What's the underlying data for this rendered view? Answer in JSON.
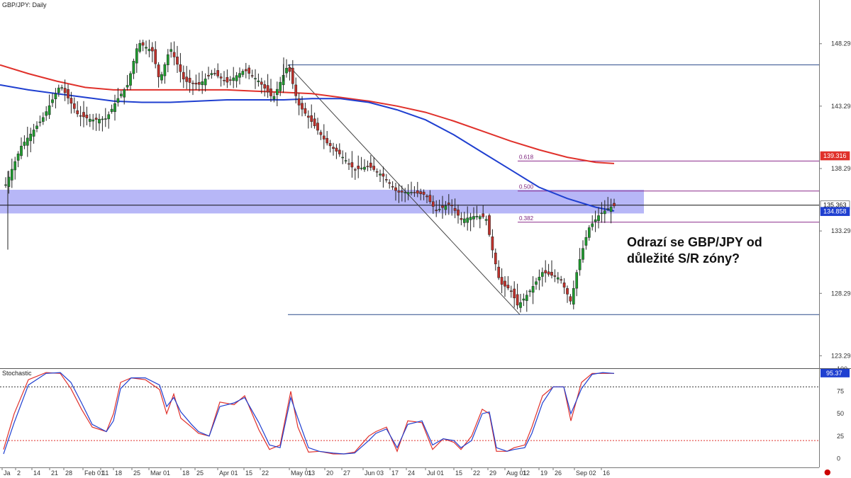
{
  "chart_data": [
    {
      "type": "candlestick",
      "title": "GBP/JPY: Daily",
      "symbol": "GBP/JPY",
      "timeframe": "Daily",
      "ylim": [
        122.3,
        151.8
      ],
      "y_ticks": [
        "148.298",
        "143.298",
        "138.298",
        "133.298",
        "128.298",
        "123.298"
      ],
      "y_tick_values": [
        148.298,
        143.298,
        138.298,
        133.298,
        128.298,
        123.298
      ],
      "x_tick_labels": [
        "Ja",
        "2",
        "14",
        "21",
        "28",
        "Feb 01",
        "11",
        "18",
        "25",
        "Mar 01",
        "18",
        "25",
        "Apr 01",
        "15",
        "22",
        "May 01",
        "13",
        "20",
        "27",
        "Jun 03",
        "17",
        "24",
        "Jul 01",
        "15",
        "22",
        "29",
        "Aug 01",
        "12",
        "19",
        "26",
        "Sep 02",
        "16"
      ],
      "price_badges": [
        {
          "label": "139.316",
          "value": 139.316,
          "color": "#e0312b"
        },
        {
          "label": "135.363",
          "value": 135.363,
          "color": "#ffffff"
        },
        {
          "label": "134.858",
          "value": 134.858,
          "color": "#1f3fd0"
        }
      ],
      "fib_levels": [
        {
          "label": "0.618",
          "value": 138.9
        },
        {
          "label": "0.500",
          "value": 136.5
        },
        {
          "label": "0.382",
          "value": 134.0
        }
      ],
      "swing_high": 146.6,
      "swing_low": 126.6,
      "sr_zone": [
        134.7,
        136.6
      ],
      "close_price": 135.363,
      "ma_red": [
        [
          0,
          146.6
        ],
        [
          40,
          145.9
        ],
        [
          80,
          145.3
        ],
        [
          120,
          144.8
        ],
        [
          160,
          144.6
        ],
        [
          200,
          144.6
        ],
        [
          240,
          144.6
        ],
        [
          280,
          144.6
        ],
        [
          320,
          144.6
        ],
        [
          360,
          144.5
        ],
        [
          400,
          144.4
        ],
        [
          440,
          144.3
        ],
        [
          480,
          144.0
        ],
        [
          520,
          143.7
        ],
        [
          560,
          143.3
        ],
        [
          600,
          142.8
        ],
        [
          640,
          142.1
        ],
        [
          680,
          141.3
        ],
        [
          720,
          140.5
        ],
        [
          760,
          139.8
        ],
        [
          800,
          139.2
        ],
        [
          840,
          138.8
        ],
        [
          866,
          138.7
        ]
      ],
      "ma_blue": [
        [
          0,
          145.0
        ],
        [
          40,
          144.6
        ],
        [
          80,
          144.3
        ],
        [
          120,
          144.0
        ],
        [
          160,
          143.7
        ],
        [
          200,
          143.6
        ],
        [
          240,
          143.6
        ],
        [
          280,
          143.7
        ],
        [
          320,
          143.8
        ],
        [
          360,
          143.8
        ],
        [
          400,
          143.8
        ],
        [
          440,
          143.9
        ],
        [
          480,
          143.9
        ],
        [
          520,
          143.6
        ],
        [
          560,
          143.0
        ],
        [
          600,
          142.2
        ],
        [
          640,
          141.0
        ],
        [
          680,
          139.6
        ],
        [
          720,
          138.2
        ],
        [
          760,
          136.8
        ],
        [
          800,
          135.9
        ],
        [
          840,
          135.2
        ],
        [
          866,
          134.9
        ]
      ],
      "price_path": [
        [
          8,
          137.0
        ],
        [
          30,
          140.1
        ],
        [
          60,
          142.3
        ],
        [
          85,
          145.0
        ],
        [
          110,
          142.6
        ],
        [
          130,
          142.2
        ],
        [
          150,
          142.3
        ],
        [
          165,
          143.8
        ],
        [
          180,
          145.0
        ],
        [
          195,
          148.4
        ],
        [
          215,
          147.7
        ],
        [
          225,
          145.3
        ],
        [
          240,
          148.0
        ],
        [
          260,
          145.3
        ],
        [
          280,
          145.0
        ],
        [
          300,
          146.0
        ],
        [
          320,
          145.2
        ],
        [
          345,
          146.2
        ],
        [
          365,
          145.3
        ],
        [
          385,
          143.9
        ],
        [
          406,
          146.6
        ],
        [
          420,
          143.5
        ],
        [
          440,
          142.0
        ],
        [
          460,
          140.4
        ],
        [
          480,
          139.4
        ],
        [
          500,
          138.2
        ],
        [
          520,
          138.5
        ],
        [
          540,
          137.7
        ],
        [
          560,
          136.4
        ],
        [
          580,
          136.4
        ],
        [
          600,
          136.2
        ],
        [
          615,
          134.9
        ],
        [
          635,
          135.5
        ],
        [
          650,
          134.2
        ],
        [
          670,
          134.5
        ],
        [
          685,
          134.4
        ],
        [
          695,
          131.6
        ],
        [
          705,
          129.1
        ],
        [
          720,
          128.6
        ],
        [
          730,
          127.3
        ],
        [
          745,
          128.3
        ],
        [
          765,
          130.0
        ],
        [
          790,
          129.5
        ],
        [
          805,
          127.6
        ],
        [
          815,
          130.5
        ],
        [
          830,
          133.5
        ],
        [
          845,
          134.6
        ],
        [
          860,
          135.2
        ],
        [
          866,
          135.3
        ]
      ],
      "price_spike": [
        [
          11,
          138.1
        ],
        [
          11,
          131.8
        ],
        [
          400,
          145.3
        ],
        [
          400,
          147.2
        ]
      ],
      "grid": false,
      "annotation": "Odrazí se GBP/JPY od důležité S/R zóny?"
    },
    {
      "type": "line",
      "title": "Stochastic",
      "ylim": [
        -10,
        100
      ],
      "y_ticks": [
        "100",
        "75",
        "50",
        "25",
        "0"
      ],
      "y_tick_values": [
        100,
        75,
        50,
        25,
        0
      ],
      "overbought": 80,
      "oversold": 20,
      "last_value_label": "95.37",
      "series": [
        {
          "color": "#e0312b",
          "points": [
            [
              5,
              10
            ],
            [
              20,
              50
            ],
            [
              40,
              88
            ],
            [
              65,
              96
            ],
            [
              85,
              95
            ],
            [
              100,
              78
            ],
            [
              115,
              55
            ],
            [
              130,
              35
            ],
            [
              150,
              30
            ],
            [
              160,
              50
            ],
            [
              170,
              85
            ],
            [
              185,
              90
            ],
            [
              205,
              88
            ],
            [
              225,
              77
            ],
            [
              235,
              50
            ],
            [
              245,
              72
            ],
            [
              255,
              45
            ],
            [
              270,
              35
            ],
            [
              280,
              28
            ],
            [
              295,
              25
            ],
            [
              310,
              63
            ],
            [
              330,
              60
            ],
            [
              345,
              70
            ],
            [
              365,
              32
            ],
            [
              380,
              10
            ],
            [
              395,
              15
            ],
            [
              410,
              75
            ],
            [
              420,
              35
            ],
            [
              435,
              7
            ],
            [
              450,
              8
            ],
            [
              470,
              5
            ],
            [
              485,
              5
            ],
            [
              500,
              7
            ],
            [
              520,
              25
            ],
            [
              530,
              30
            ],
            [
              545,
              35
            ],
            [
              560,
              8
            ],
            [
              575,
              42
            ],
            [
              595,
              40
            ],
            [
              610,
              10
            ],
            [
              625,
              22
            ],
            [
              640,
              18
            ],
            [
              650,
              10
            ],
            [
              665,
              25
            ],
            [
              680,
              55
            ],
            [
              690,
              50
            ],
            [
              700,
              8
            ],
            [
              715,
              8
            ],
            [
              725,
              12
            ],
            [
              740,
              15
            ],
            [
              750,
              35
            ],
            [
              765,
              70
            ],
            [
              780,
              80
            ],
            [
              795,
              80
            ],
            [
              805,
              42
            ],
            [
              820,
              85
            ],
            [
              835,
              95
            ],
            [
              850,
              95
            ],
            [
              866,
              95
            ]
          ]
        },
        {
          "color": "#1f3fd0",
          "points": [
            [
              5,
              5
            ],
            [
              20,
              40
            ],
            [
              40,
              82
            ],
            [
              65,
              95
            ],
            [
              85,
              96
            ],
            [
              100,
              85
            ],
            [
              115,
              62
            ],
            [
              130,
              38
            ],
            [
              150,
              30
            ],
            [
              160,
              42
            ],
            [
              170,
              78
            ],
            [
              185,
              90
            ],
            [
              205,
              90
            ],
            [
              225,
              82
            ],
            [
              235,
              58
            ],
            [
              245,
              68
            ],
            [
              255,
              52
            ],
            [
              270,
              38
            ],
            [
              280,
              30
            ],
            [
              295,
              25
            ],
            [
              310,
              58
            ],
            [
              330,
              62
            ],
            [
              345,
              68
            ],
            [
              365,
              40
            ],
            [
              380,
              15
            ],
            [
              395,
              12
            ],
            [
              410,
              68
            ],
            [
              420,
              45
            ],
            [
              435,
              12
            ],
            [
              450,
              8
            ],
            [
              470,
              6
            ],
            [
              485,
              5
            ],
            [
              500,
              6
            ],
            [
              520,
              20
            ],
            [
              530,
              28
            ],
            [
              545,
              33
            ],
            [
              560,
              12
            ],
            [
              575,
              38
            ],
            [
              595,
              42
            ],
            [
              610,
              15
            ],
            [
              625,
              22
            ],
            [
              640,
              20
            ],
            [
              650,
              12
            ],
            [
              665,
              20
            ],
            [
              680,
              50
            ],
            [
              690,
              52
            ],
            [
              700,
              12
            ],
            [
              715,
              8
            ],
            [
              725,
              10
            ],
            [
              740,
              12
            ],
            [
              750,
              28
            ],
            [
              765,
              62
            ],
            [
              780,
              80
            ],
            [
              795,
              80
            ],
            [
              805,
              50
            ],
            [
              820,
              78
            ],
            [
              835,
              94
            ],
            [
              850,
              96
            ],
            [
              866,
              95
            ]
          ]
        }
      ]
    }
  ]
}
